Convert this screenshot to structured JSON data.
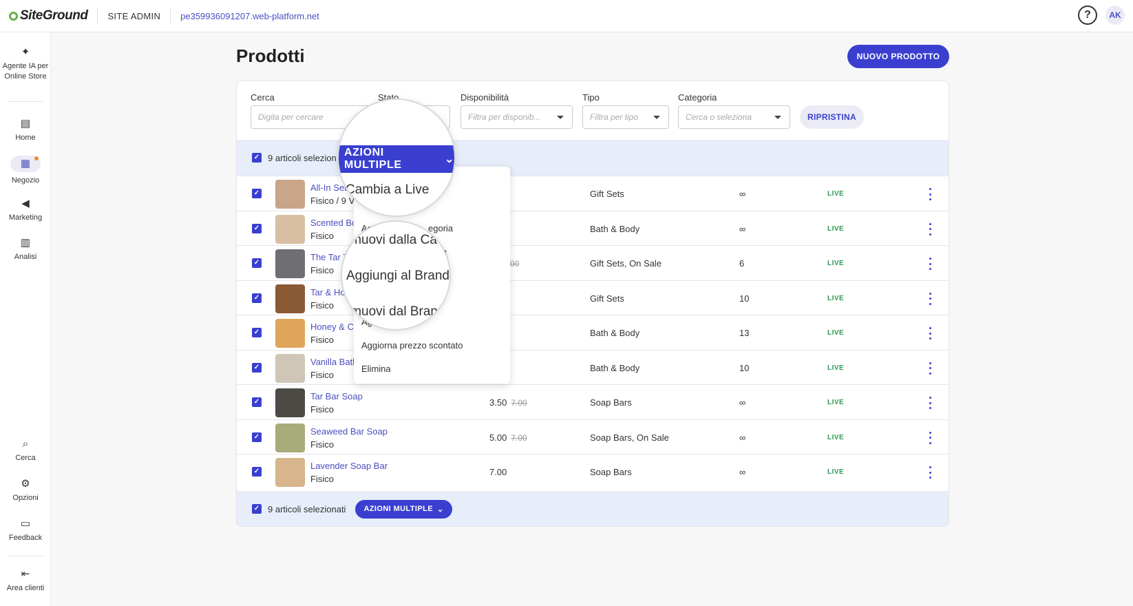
{
  "topbar": {
    "logo": "SiteGround",
    "site_admin": "SITE ADMIN",
    "site_url": "pe359936091207.web-platform.net",
    "help": "?",
    "avatar": "AK"
  },
  "sidebar": {
    "items": [
      {
        "label": "Agente IA per Online Store",
        "icon": "sparkle-icon"
      },
      {
        "label": "Home",
        "icon": "home-icon"
      },
      {
        "label": "Negozio",
        "icon": "store-icon"
      },
      {
        "label": "Marketing",
        "icon": "megaphone-icon"
      },
      {
        "label": "Analisi",
        "icon": "chart-icon"
      },
      {
        "label": "Cerca",
        "icon": "search-icon"
      },
      {
        "label": "Opzioni",
        "icon": "gear-icon"
      },
      {
        "label": "Feedback",
        "icon": "feedback-icon"
      },
      {
        "label": "Area clienti",
        "icon": "logout-icon"
      }
    ],
    "active_color": "#4b4fbf"
  },
  "page": {
    "title": "Prodotti",
    "new_button": "NUOVO PRODOTTO"
  },
  "filters": {
    "search_label": "Cerca",
    "search_placeholder": "Digita per cercare",
    "status_label": "Stato",
    "availability_label": "Disponibilità",
    "availability_placeholder": "Filtra per disponib...",
    "type_label": "Tipo",
    "type_placeholder": "Filtra per tipo",
    "category_label": "Categoria",
    "category_placeholder": "Cerca o seleziona",
    "reset_button": "RIPRISTINA"
  },
  "selection": {
    "top_text": "9 articoli selezion",
    "bottom_text": "9 articoli selezionati",
    "multi_button": "AZIONI MULTIPLE"
  },
  "products": [
    {
      "name": "All-In Set",
      "type": "Fisico / 9 Va",
      "price": "",
      "old_price": "",
      "category": "Gift Sets",
      "stock": "∞",
      "status": "LIVE",
      "thumb": "#c9a58a"
    },
    {
      "name": "Scented Bo",
      "type": "Fisico",
      "price": "0",
      "old_price": "",
      "category": "Bath & Body",
      "stock": "∞",
      "status": "LIVE",
      "thumb": "#d8bfa3"
    },
    {
      "name": "The Tar T",
      "type": "Fisico",
      "price": "0",
      "old_price": "32.00",
      "category": "Gift Sets, On Sale",
      "stock": "6",
      "status": "LIVE",
      "thumb": "#6f6f73"
    },
    {
      "name": "Tar & Ho",
      "type": "Fisico",
      "price": "0",
      "old_price": "",
      "category": "Gift Sets",
      "stock": "10",
      "status": "LIVE",
      "thumb": "#8a5a34"
    },
    {
      "name": "Honey & Ci",
      "type": "Fisico",
      "price": "0",
      "old_price": "",
      "category": "Bath & Body",
      "stock": "13",
      "status": "LIVE",
      "thumb": "#e0a55c"
    },
    {
      "name": "Vanilla Bath",
      "type": "Fisico",
      "price": "0",
      "old_price": "",
      "category": "Bath & Body",
      "stock": "10",
      "status": "LIVE",
      "thumb": "#cfc6b8"
    },
    {
      "name": "Tar Bar Soap",
      "type": "Fisico",
      "price": "3.50",
      "old_price": "7.00",
      "category": "Soap Bars",
      "stock": "∞",
      "status": "LIVE",
      "thumb": "#4d4a46"
    },
    {
      "name": "Seaweed Bar Soap",
      "type": "Fisico",
      "price": "5.00",
      "old_price": "7.00",
      "category": "Soap Bars, On Sale",
      "stock": "∞",
      "status": "LIVE",
      "thumb": "#a8ab7a"
    },
    {
      "name": "Lavender Soap Bar",
      "type": "Fisico",
      "price": "7.00",
      "old_price": "",
      "category": "Soap Bars",
      "stock": "∞",
      "status": "LIVE",
      "thumb": "#d8b58c"
    }
  ],
  "dropdown": {
    "items": [
      "Ag",
      "egoria",
      "a",
      "Ag",
      "Aggiorna prezzo scontato",
      "Elimina"
    ]
  },
  "lenses": {
    "top_button": "AZIONI MULTIPLE",
    "top_item": "Cambia a Live",
    "mid_item_above": "imuovi dalla Ca",
    "mid_item": "Aggiungi al Brand",
    "mid_item_below": "imuovi dal Bran"
  },
  "colors": {
    "accent": "#3a3fd0",
    "live": "#2e9a50",
    "selection_bg": "#e7edf9"
  }
}
